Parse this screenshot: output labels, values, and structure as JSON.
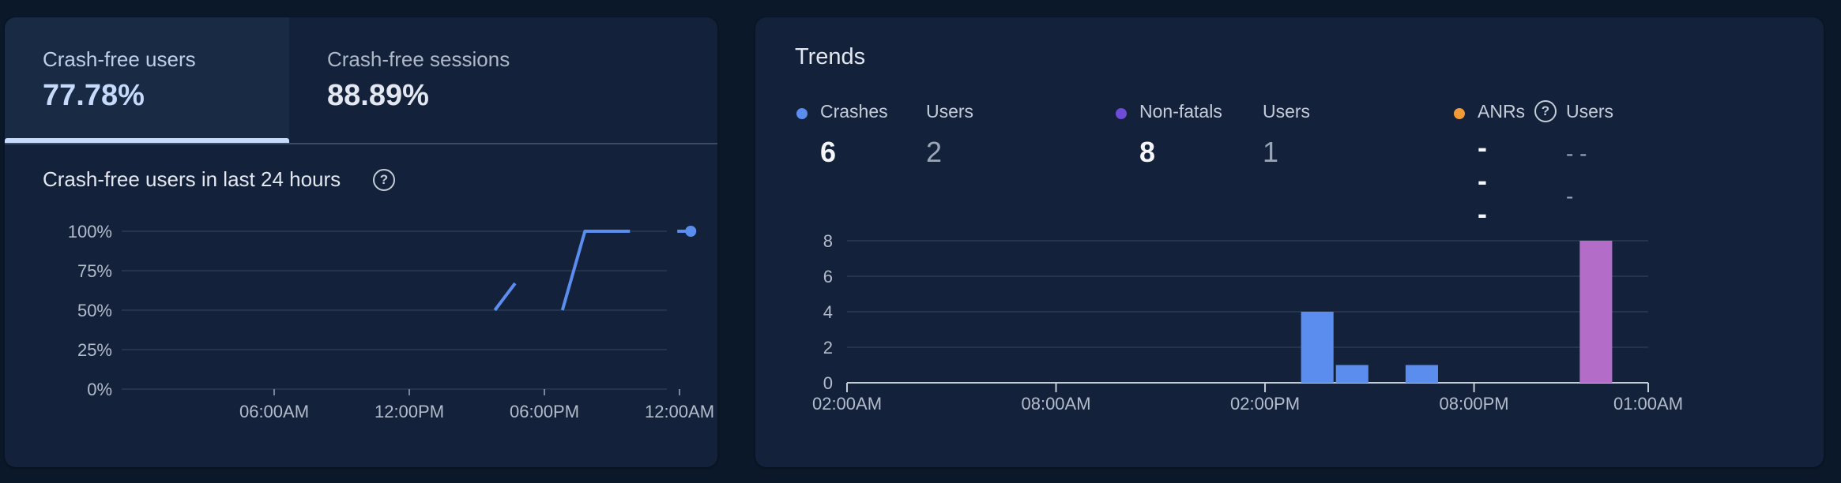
{
  "left_card": {
    "tabs": [
      {
        "label": "Crash-free users",
        "value": "77.78%"
      },
      {
        "label": "Crash-free sessions",
        "value": "88.89%"
      }
    ],
    "chart_title": "Crash-free users in last 24 hours",
    "help_icon": "help-circle-icon"
  },
  "trends": {
    "title": "Trends",
    "metrics": [
      {
        "name": "Crashes",
        "value": "6",
        "users_label": "Users",
        "users_value": "2",
        "color": "#5b8def"
      },
      {
        "name": "Non-fatals",
        "value": "8",
        "users_label": "Users",
        "users_value": "1",
        "color": "#6e4bd8"
      },
      {
        "name": "ANRs",
        "value": "- - -",
        "users_label": "Users",
        "users_value": "- -\n-",
        "color": "#f29a38",
        "help_icon": "help-circle-icon"
      }
    ]
  },
  "chart_data": [
    {
      "type": "line",
      "title": "Crash-free users in last 24 hours",
      "x_tick_labels": [
        "06:00AM",
        "12:00PM",
        "06:00PM",
        "12:00AM"
      ],
      "y_tick_labels": [
        "100%",
        "75%",
        "50%",
        "25%",
        "0%"
      ],
      "ylim": [
        0,
        100
      ],
      "grid": true,
      "series": [
        {
          "segments": [
            [
              [
                15.8,
                50
              ],
              [
                16.7,
                67
              ]
            ],
            [
              [
                18.8,
                50
              ],
              [
                19.8,
                100
              ],
              [
                21.8,
                100
              ]
            ],
            [
              [
                23.9,
                100
              ],
              [
                24.5,
                100
              ]
            ]
          ],
          "last_point": [
            24.5,
            100
          ],
          "color": "#5b8def"
        }
      ]
    },
    {
      "type": "bar",
      "x_tick_labels": [
        "02:00AM",
        "08:00AM",
        "02:00PM",
        "08:00PM",
        "01:00AM"
      ],
      "y_tick_labels": [
        "8",
        "6",
        "4",
        "2",
        "0"
      ],
      "ylim": [
        0,
        8
      ],
      "grid": true,
      "series": [
        {
          "name": "Crashes",
          "color": "#5b8def",
          "bars": [
            {
              "x": "03:00PM",
              "value": 4
            },
            {
              "x": "04:00PM",
              "value": 1
            },
            {
              "x": "06:00PM",
              "value": 1
            }
          ]
        },
        {
          "name": "Non-fatals",
          "color": "#b36dc9",
          "bars": [
            {
              "x": "11:00PM",
              "value": 8
            }
          ]
        }
      ]
    }
  ]
}
